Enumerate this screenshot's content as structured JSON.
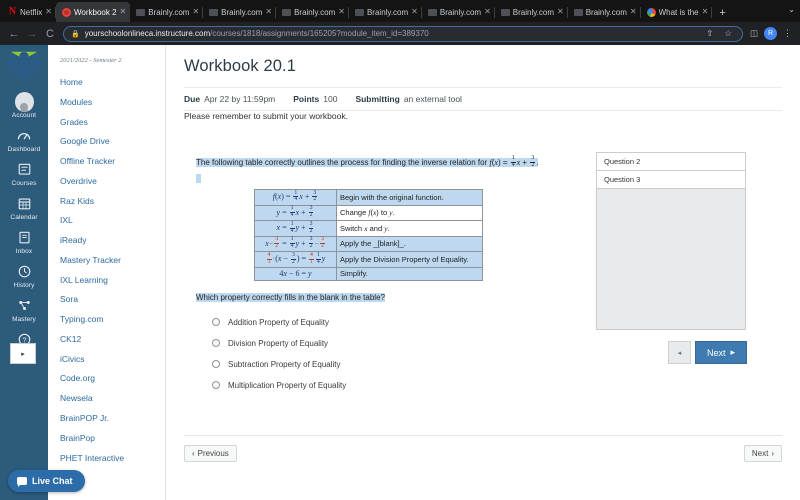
{
  "browser": {
    "tabs": [
      {
        "title": "Netflix",
        "favicon": "netflix-icon",
        "active": false
      },
      {
        "title": "Workbook 2",
        "favicon": "canvas-icon",
        "active": true
      },
      {
        "title": "Brainly.com",
        "favicon": "brainly-icon",
        "active": false
      },
      {
        "title": "Brainly.com",
        "favicon": "brainly-icon",
        "active": false
      },
      {
        "title": "Brainly.com",
        "favicon": "brainly-icon",
        "active": false
      },
      {
        "title": "Brainly.com",
        "favicon": "brainly-icon",
        "active": false
      },
      {
        "title": "Brainly.com",
        "favicon": "brainly-icon",
        "active": false
      },
      {
        "title": "Brainly.com",
        "favicon": "brainly-icon",
        "active": false
      },
      {
        "title": "Brainly.com",
        "favicon": "brainly-icon",
        "active": false
      },
      {
        "title": "What is the",
        "favicon": "chrome-icon",
        "active": false
      }
    ],
    "new_tab_label": "+",
    "tab_list_label": "⌄",
    "back_label": "←",
    "forward_label": "→",
    "reload_label": "↻",
    "lock_label": "🔒",
    "url_host": "yourschoolonlineca.instructure.com",
    "url_path": "/courses/1818/assignments/165205?module_item_id=389370",
    "share_label": "⇧",
    "bookmark_label": "☆",
    "sidepanel_label": "◫",
    "profile_initial": "R",
    "menu_label": "⋮"
  },
  "global_nav": {
    "items": [
      {
        "label": "Account",
        "icon": "user-avatar-icon"
      },
      {
        "label": "Dashboard",
        "icon": "dashboard-icon"
      },
      {
        "label": "Courses",
        "icon": "courses-icon"
      },
      {
        "label": "Calendar",
        "icon": "calendar-icon"
      },
      {
        "label": "Inbox",
        "icon": "inbox-icon"
      },
      {
        "label": "History",
        "icon": "clock-icon"
      },
      {
        "label": "Mastery",
        "icon": "mastery-icon"
      },
      {
        "label": "Help",
        "icon": "help-icon"
      }
    ],
    "collapse_label": "▸"
  },
  "course_nav": {
    "term": "2021/2022 - Semester 2",
    "items": [
      {
        "label": "Home"
      },
      {
        "label": "Modules"
      },
      {
        "label": "Grades"
      },
      {
        "label": "Google Drive"
      },
      {
        "label": "Offline Tracker"
      },
      {
        "label": "Overdrive"
      },
      {
        "label": "Raz Kids"
      },
      {
        "label": "IXL"
      },
      {
        "label": "iReady"
      },
      {
        "label": "Mastery Tracker"
      },
      {
        "label": "IXL Learning"
      },
      {
        "label": "Sora"
      },
      {
        "label": "Typing.com"
      },
      {
        "label": "CK12"
      },
      {
        "label": "iCivics"
      },
      {
        "label": "Code.org"
      },
      {
        "label": "Newsela"
      },
      {
        "label": "BrainPOP Jr."
      },
      {
        "label": "BrainPop"
      },
      {
        "label": "PHET Interactive"
      }
    ]
  },
  "live_chat": {
    "label": "Live Chat",
    "color": "#2c6ca8"
  },
  "assignment": {
    "title": "Workbook 20.1",
    "due_key": "Due",
    "due_value": "Apr 22 by 11:59pm",
    "points_key": "Points",
    "points_value": "100",
    "submitting_key": "Submitting",
    "submitting_value": "an external tool",
    "instruction": "Please remember to submit your workbook."
  },
  "question": {
    "stem_prefix": "The following table correctly outlines the process for finding the inverse relation for",
    "stem_function": "f(x) = 1/4 x + 3/2.",
    "prompt": "Which property correctly fills in the blank in the table?",
    "table_rows": [
      {
        "equation": "f(x) = 1/4 x + 3/2",
        "description": "Begin with the original function.",
        "highlight": false
      },
      {
        "equation": "y = 1/4 x + 3/2",
        "description": "Change f(x) to y.",
        "highlight": false
      },
      {
        "equation": "x = 1/4 y + 3/2",
        "description": "Switch x and y.",
        "highlight": false
      },
      {
        "equation": "x - 3/2 = 1/4 y + 3/2 - 3/2",
        "description": "Apply the _[blank]_.",
        "highlight": true
      },
      {
        "equation": "4/1 · (x - 3/2) = 4/1 · 1/4 y",
        "description": "Apply the Division Property of Equality.",
        "highlight": true
      },
      {
        "equation": "4x - 6 = y",
        "description": "Simplify.",
        "highlight": false
      }
    ],
    "answers": [
      {
        "label": "Addition Property of Equality",
        "selected": false
      },
      {
        "label": "Division Property of Equality",
        "selected": false
      },
      {
        "label": "Subtraction Property of Equality",
        "selected": false
      },
      {
        "label": "Multiplication Property of Equality",
        "selected": false
      }
    ]
  },
  "question_list": {
    "items": [
      {
        "label": "Question 2"
      },
      {
        "label": "Question 3"
      }
    ],
    "prev_label": "◂",
    "next_label": "Next",
    "next_arrow": "▸"
  },
  "bottom_nav": {
    "previous_label": "Previous",
    "previous_arrow": "‹",
    "next_label": "Next",
    "next_arrow": "›"
  }
}
